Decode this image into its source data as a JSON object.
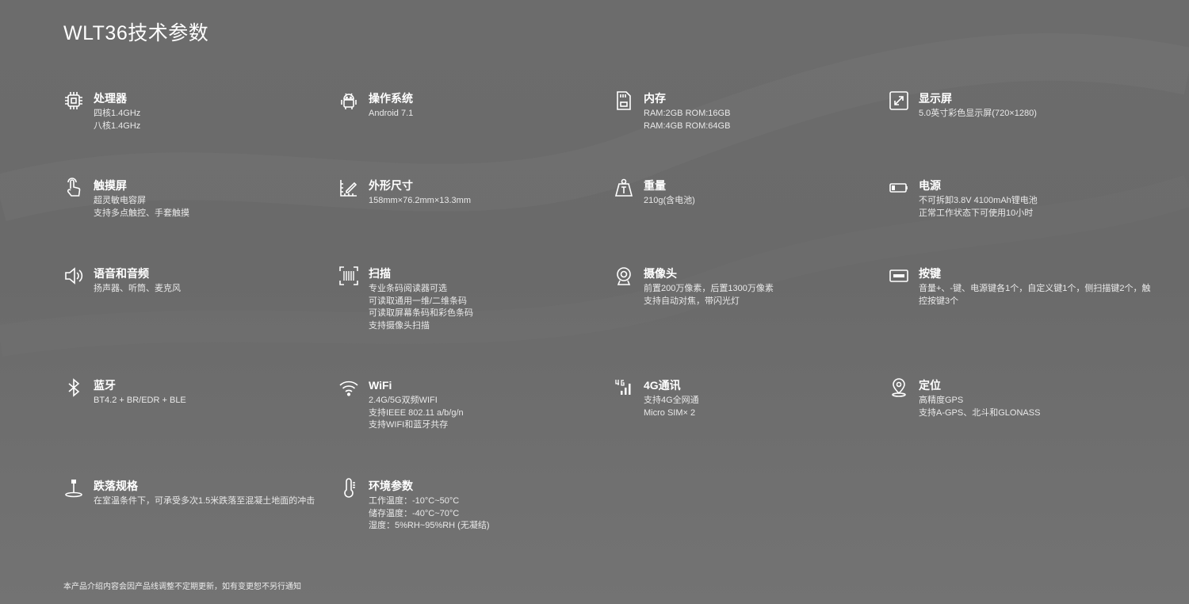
{
  "page_title": "WLT36技术参数",
  "specs": [
    {
      "icon": "cpu-chip-icon",
      "label": "处理器",
      "lines": [
        "四核1.4GHz",
        "八核1.4GHz"
      ]
    },
    {
      "icon": "android-robot-icon",
      "label": "操作系统",
      "lines": [
        "Android 7.1"
      ]
    },
    {
      "icon": "memory-card-icon",
      "label": "内存",
      "lines": [
        "RAM:2GB ROM:16GB",
        "RAM:4GB ROM:64GB"
      ]
    },
    {
      "icon": "expand-screen-icon",
      "label": "显示屏",
      "lines": [
        "5.0英寸彩色显示屏(720×1280)"
      ]
    },
    {
      "icon": "touch-hand-icon",
      "label": "触摸屏",
      "lines": [
        "超灵敏电容屏",
        "支持多点触控、手套触摸"
      ]
    },
    {
      "icon": "ruler-pencil-icon",
      "label": "外形尺寸",
      "lines": [
        "158mm×76.2mm×13.3mm"
      ]
    },
    {
      "icon": "weight-icon",
      "label": "重量",
      "lines": [
        "210g(含电池)"
      ]
    },
    {
      "icon": "battery-icon",
      "label": "电源",
      "lines": [
        "不可拆卸3.8V 4100mAh锂电池",
        "正常工作状态下可使用10小时"
      ]
    },
    {
      "icon": "speaker-icon",
      "label": "语音和音频",
      "lines": [
        "扬声器、听筒、麦克风"
      ]
    },
    {
      "icon": "barcode-scan-icon",
      "label": "扫描",
      "lines": [
        "专业条码阅读器可选",
        "可读取通用一维/二维条码",
        "可读取屏幕条码和彩色条码",
        "支持摄像头扫描"
      ]
    },
    {
      "icon": "webcam-icon",
      "label": "摄像头",
      "lines": [
        "前置200万像素，后置1300万像素",
        "支持自动对焦，带闪光灯"
      ]
    },
    {
      "icon": "keyboard-key-icon",
      "label": "按键",
      "lines": [
        "音量+、-键、电源键各1个，自定义键1个，侧扫描键2个，触控按键3个"
      ]
    },
    {
      "icon": "bluetooth-icon",
      "label": "蓝牙",
      "lines": [
        "BT4.2 + BR/EDR + BLE"
      ]
    },
    {
      "icon": "wifi-icon",
      "label": "WiFi",
      "lines": [
        "2.4G/5G双频WIFI",
        "支持IEEE 802.11 a/b/g/n",
        "支持WIFI和蓝牙共存"
      ]
    },
    {
      "icon": "signal-4g-icon",
      "label": "4G通讯",
      "lines": [
        "支持4G全网通",
        "Micro SIM× 2"
      ]
    },
    {
      "icon": "location-pin-icon",
      "label": "定位",
      "lines": [
        "高精度GPS",
        "支持A-GPS、北斗和GLONASS"
      ]
    },
    {
      "icon": "drop-test-icon",
      "label": "跌落规格",
      "lines": [
        "在室温条件下，可承受多次1.5米跌落至混凝土地面的冲击"
      ]
    },
    {
      "icon": "thermometer-icon",
      "label": "环境参数",
      "lines": [
        "工作温度：-10°C~50°C",
        "储存温度：-40°C~70°C",
        "湿度：5%RH~95%RH (无凝结)"
      ]
    }
  ],
  "footnote": "本产品介绍内容会因产品线调整不定期更新，如有变更恕不另行通知"
}
